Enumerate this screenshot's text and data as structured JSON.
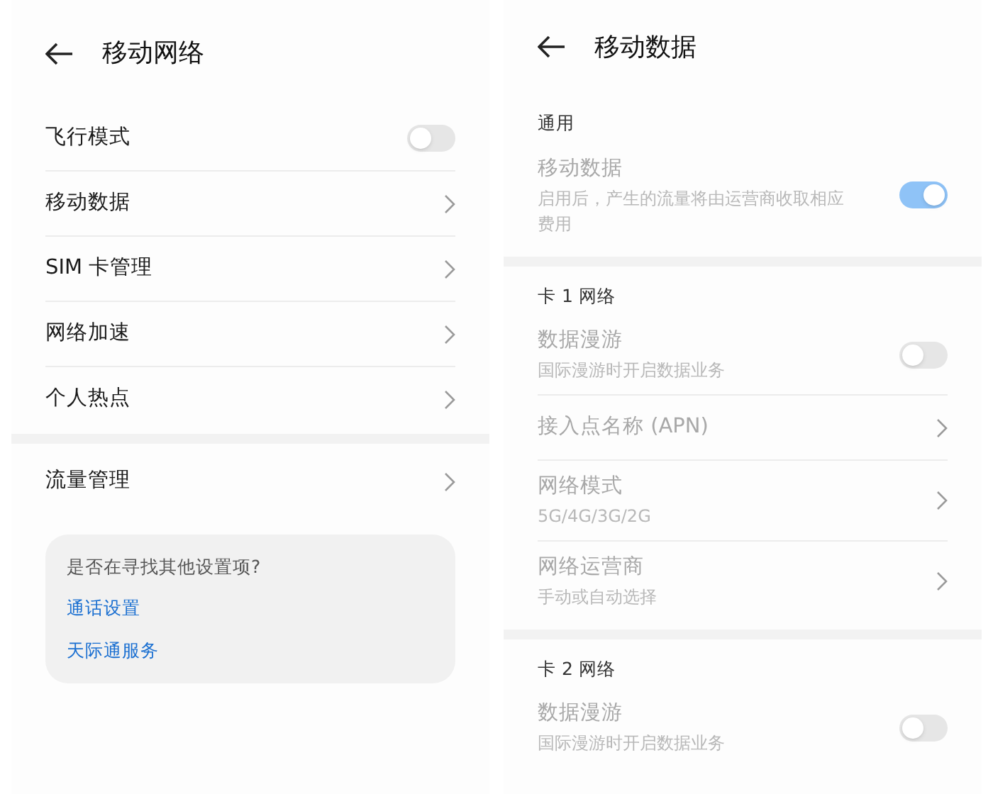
{
  "left": {
    "title": "移动网络",
    "sections": [
      {
        "items": [
          {
            "kind": "toggle",
            "label": "飞行模式",
            "on": false
          },
          {
            "kind": "link",
            "label": "移动数据"
          },
          {
            "kind": "link",
            "label": "SIM 卡管理"
          },
          {
            "kind": "link",
            "label": "网络加速"
          },
          {
            "kind": "link",
            "label": "个人热点"
          }
        ]
      },
      {
        "items": [
          {
            "kind": "link",
            "label": "流量管理"
          }
        ]
      }
    ],
    "suggestion": {
      "question": "是否在寻找其他设置项?",
      "links": [
        "通话设置",
        "天际通服务"
      ]
    }
  },
  "right": {
    "title": "移动数据",
    "sections": [
      {
        "header": "通用",
        "items": [
          {
            "kind": "toggle",
            "label": "移动数据",
            "description": "启用后，产生的流量将由运营商收取相应费用",
            "on": true,
            "disabled": true
          }
        ]
      },
      {
        "header": "卡 1 网络",
        "items": [
          {
            "kind": "toggle",
            "label": "数据漫游",
            "description": "国际漫游时开启数据业务",
            "on": false,
            "disabled": true
          },
          {
            "kind": "link",
            "label": "接入点名称 (APN)",
            "disabled": true
          },
          {
            "kind": "link",
            "label": "网络模式",
            "description": "5G/4G/3G/2G",
            "disabled": true
          },
          {
            "kind": "link",
            "label": "网络运营商",
            "description": "手动或自动选择",
            "disabled": true
          }
        ]
      },
      {
        "header": "卡 2 网络",
        "items": [
          {
            "kind": "toggle",
            "label": "数据漫游",
            "description": "国际漫游时开启数据业务",
            "on": false,
            "disabled": true
          }
        ]
      }
    ]
  }
}
